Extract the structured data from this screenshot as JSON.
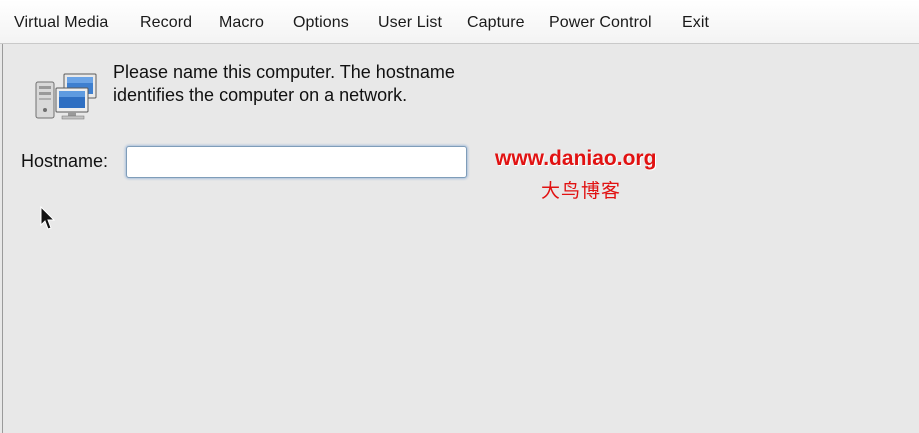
{
  "menubar": {
    "items": [
      {
        "label": "Virtual Media"
      },
      {
        "label": "Record"
      },
      {
        "label": "Macro"
      },
      {
        "label": "Options"
      },
      {
        "label": "User List"
      },
      {
        "label": "Capture"
      },
      {
        "label": "Power Control"
      },
      {
        "label": "Exit"
      }
    ]
  },
  "dialog": {
    "instruction": "Please name this computer.  The hostname identifies the computer on a network.",
    "hostname_label": "Hostname:",
    "hostname_value": "",
    "icon": "network-computers-icon"
  },
  "watermark": {
    "url": "www.daniao.org",
    "text_cn": "大鸟博客",
    "color": "#e11212"
  },
  "cursor": {
    "icon": "mouse-pointer-icon"
  }
}
